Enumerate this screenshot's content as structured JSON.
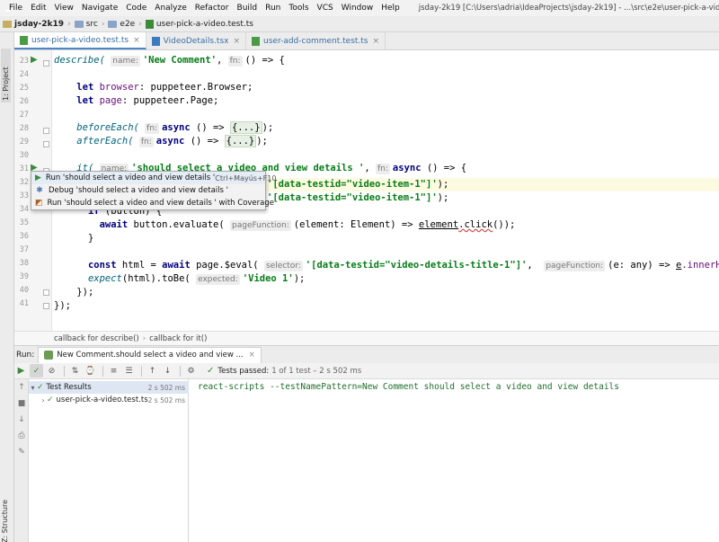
{
  "menubar": {
    "items": [
      "File",
      "Edit",
      "View",
      "Navigate",
      "Code",
      "Analyze",
      "Refactor",
      "Build",
      "Run",
      "Tools",
      "VCS",
      "Window",
      "Help"
    ],
    "window_title": "jsday-2k19 [C:\\Users\\adria\\IdeaProjects\\jsday-2k19] - ...\\src\\e2e\\user-pick-a-video.test.ts - IntelliJ IDEA"
  },
  "breadcrumb": {
    "project": "jsday-2k19",
    "folders": [
      "src",
      "e2e"
    ],
    "file": "user-pick-a-video.test.ts"
  },
  "left_strip": {
    "project_tab": "1: Project",
    "structure_tab": "Z: Structure"
  },
  "tabs": [
    {
      "label": "user-pick-a-video.test.ts",
      "active": true
    },
    {
      "label": "VideoDetails.tsx",
      "active": false
    },
    {
      "label": "user-add-comment.test.ts",
      "active": false
    }
  ],
  "editor": {
    "line_numbers": [
      "23",
      "24",
      "25",
      "26",
      "27",
      "28",
      "29",
      "30",
      "31",
      "32",
      "33",
      "34",
      "35",
      "36",
      "37",
      "38",
      "39"
    ],
    "hints": {
      "name": "name:",
      "fn": "fn:",
      "page_function": "pageFunction:",
      "selector": "selector:",
      "expected": "expected:"
    },
    "code": {
      "l23_describe": "describe(",
      "l23_name": "'New Comment'",
      "l23_rest": "() => {",
      "l25_let": "let",
      "l25_var": "browser",
      "l25_type": ": puppeteer.Browser;",
      "l26_let": "let",
      "l26_var": "page",
      "l26_type": ": puppeteer.Page;",
      "l28_before": "beforeEach(",
      "l28_async": "async",
      "l28_arrow": "() =>",
      "l28_body": "{...}",
      "l28_end": ");",
      "l29_after": "afterEach(",
      "l29_async": "async",
      "l29_arrow": "() =>",
      "l29_body": "{...}",
      "l29_end": ");",
      "l31_it": "it(",
      "l31_name": "'should select a video and view details '",
      "l31_comma": ",",
      "l31_async": "async",
      "l31_rest": "() => {",
      "l32_selector": "'[data-testid=\"video-item-1\"]'",
      "l32_end": ");",
      "l33_selector": "'[data-testid=\"video-item-1\"]'",
      "l33_end": ");",
      "l34_if": "if",
      "l34_rest": "(button) {",
      "l35_await": "await",
      "l35_call": "button.evaluate(",
      "l35_param": "(element",
      "l35_type": ": Element) =>",
      "l35_el": "element",
      "l35_click": ".click",
      "l35_end": "());",
      "l36_close": "}",
      "l38_const": "const",
      "l38_html": "html",
      "l38_eq": "=",
      "l38_await": "await",
      "l38_eval": "page.$eval(",
      "l38_selector": "'[data-testid=\"video-details-title-1\"]'",
      "l38_comma": ",",
      "l38_arrow": "(e: any) =>",
      "l38_e": "e",
      "l38_inner": ".innerHTML",
      "l38_end": ");",
      "l39_expect": "expect",
      "l39_html": "(html).",
      "l39_tobe": "toBe(",
      "l39_value": "'Video 1'",
      "l39_end": ");",
      "l40_close": "});",
      "l41_close": "});"
    }
  },
  "popup": {
    "items": [
      {
        "label": "Run 'should select a video and view details '",
        "shortcut": "Ctrl+Mayús+F10"
      },
      {
        "label": "Debug 'should select a video and view details '",
        "shortcut": ""
      },
      {
        "label": "Run 'should select a video and view details ' with Coverage",
        "shortcut": ""
      }
    ]
  },
  "editor_crumbs": [
    "callback for describe()",
    "callback for it()"
  ],
  "run_panel": {
    "label": "Run:",
    "tab_title": "New Comment.should select a video and view ...",
    "status_main": "Tests passed:",
    "status_detail": "1 of 1 test – 2 s 502 ms",
    "tree": [
      {
        "label": "Test Results",
        "duration": "2 s 502 ms"
      },
      {
        "label": "user-pick-a-video.test.ts",
        "duration": "2 s 502 ms"
      }
    ],
    "console": "react-scripts --testNamePattern=New Comment should select a video and view details"
  }
}
